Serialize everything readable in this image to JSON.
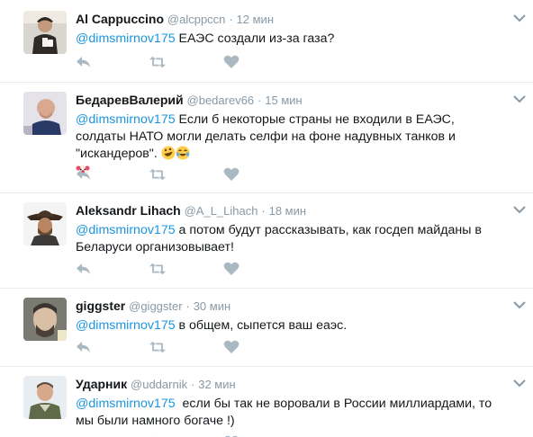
{
  "tweets": [
    {
      "name": "Al Cappuccino",
      "handle": "@alcppccn",
      "dot": "·",
      "time": "12 мин",
      "mention": "@dimsmirnov175",
      "text": " ЕАЭС создали из-за газа?"
    },
    {
      "name": "БедаревВалерий",
      "handle": "@bedarev66",
      "dot": "·",
      "time": "15 мин",
      "mention": "@dimsmirnov175",
      "text": " Если б некоторые страны не входили в ЕАЭС, солдаты НАТО могли делать селфи на фоне надувных танков и \"искандеров\".",
      "emojis": [
        "rofl-emoji",
        "tears-of-joy-emoji",
        "clown-emoji"
      ]
    },
    {
      "name": "Aleksandr Lihach",
      "handle": "@A_L_Lihach",
      "dot": "·",
      "time": "18 мин",
      "mention": "@dimsmirnov175",
      "text": " а потом будут рассказывать, как госдеп майданы в Беларуси организовывает!"
    },
    {
      "name": "giggster",
      "handle": "@giggster",
      "dot": "·",
      "time": "30 мин",
      "mention": "@dimsmirnov175",
      "text": " в общем, сыпется ваш еаэс."
    },
    {
      "name": "Ударник",
      "handle": "@uddarnik",
      "dot": "·",
      "time": "32 мин",
      "mention": "@dimsmirnov175",
      "text": "  если бы так не воровали в России миллиардами, то мы были намного богаче !)"
    }
  ],
  "colors": {
    "link": "#1b95e0",
    "muted": "#8899a6",
    "icon": "#aab8c2",
    "divider": "#e6ecf0"
  },
  "icons": {
    "reply": "reply-icon",
    "retweet": "retweet-icon",
    "like": "heart-icon",
    "menu": "chevron-down-icon"
  }
}
